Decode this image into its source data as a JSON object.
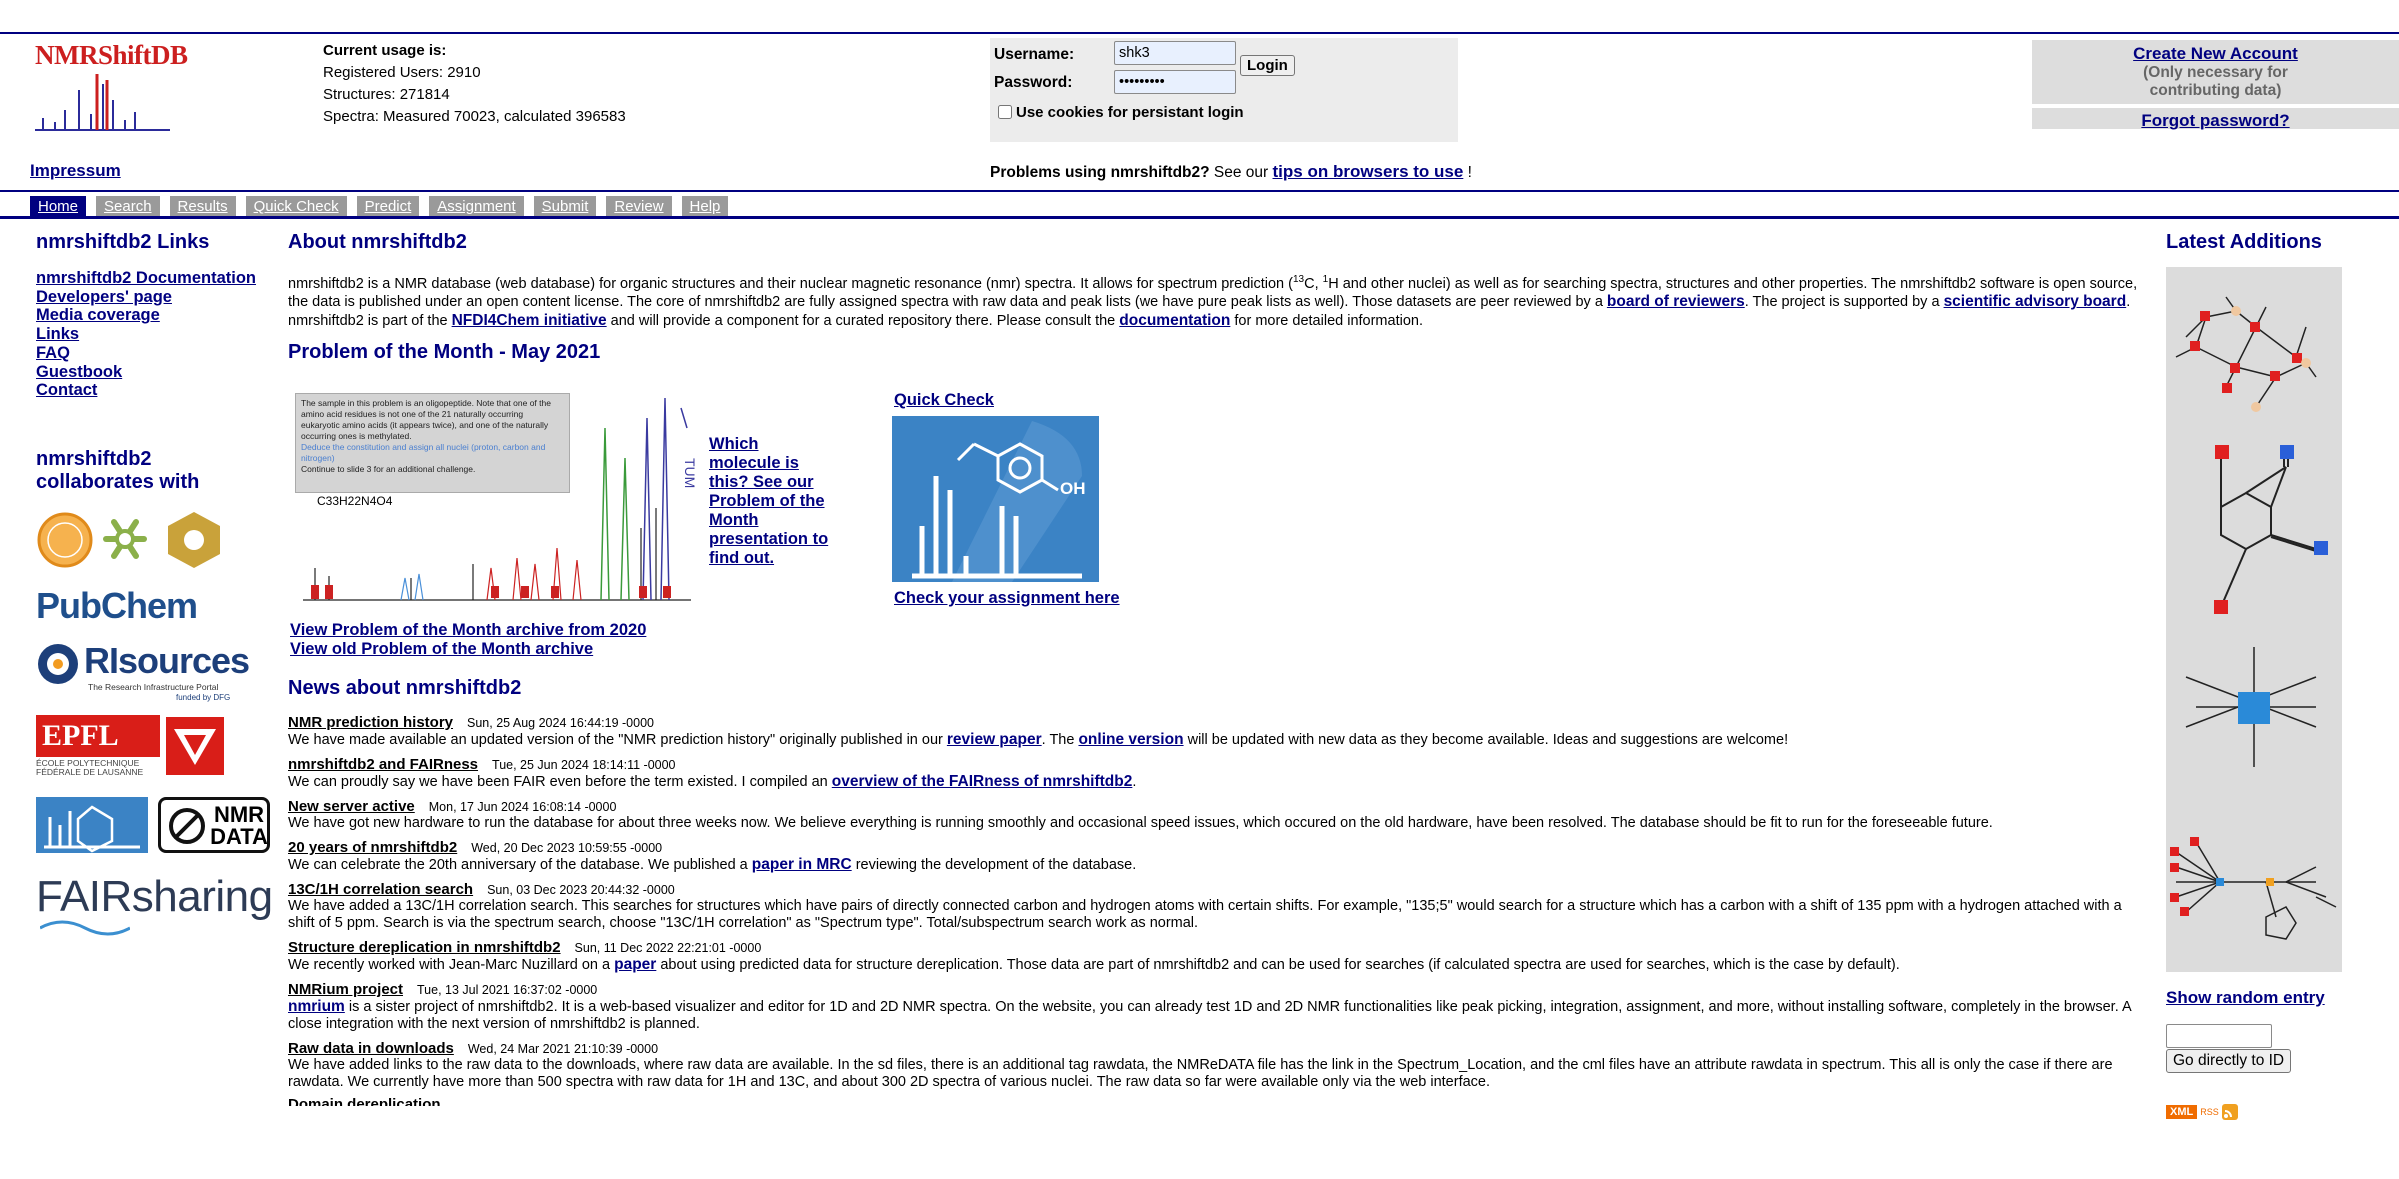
{
  "header": {
    "logo_text": "NMRShiftDB",
    "usage_heading": "Current usage is:",
    "registered_users": "Registered Users: 2910",
    "structures": "Structures: 271814",
    "spectra": "Spectra: Measured 70023, calculated 396583",
    "impressum": "Impressum"
  },
  "login": {
    "username_label": "Username:",
    "username_value": "shk3",
    "password_label": "Password:",
    "password_value": "•••••••••",
    "login_button": "Login",
    "cookie_label": "Use cookies for persistant login"
  },
  "account": {
    "create": "Create New Account",
    "note": "(Only necessary for contributing data)",
    "forgot": "Forgot password?"
  },
  "problems": {
    "prefix": "Problems using nmrshiftdb2?",
    "middle": " See our ",
    "link": "tips on browsers to use",
    "suffix": " !"
  },
  "tabs": [
    "Home",
    "Search",
    "Results",
    "Quick Check",
    "Predict",
    "Assignment",
    "Submit",
    "Review",
    "Help"
  ],
  "left": {
    "links_title": "nmrshiftdb2 Links",
    "links": [
      "nmrshiftdb2 Documentation",
      "Developers' page",
      "Media coverage",
      "Links",
      "FAQ",
      "Guestbook",
      "Contact"
    ],
    "collab_title": "nmrshiftdb2 collaborates with",
    "pubchem": "PubChem",
    "risources": "RIsources",
    "risources_sub": "The Research Infrastructure Portal",
    "risources_funded": "funded by DFG",
    "epfl": "EPFL",
    "epfl_sub1": "ÉCOLE POLYTECHNIQUE",
    "epfl_sub2": "FÉDÉRALE DE LAUSANNE",
    "nmrdata": "NMR DATA",
    "fairsharing": "FAIRsharing"
  },
  "main": {
    "about_title": "About nmrshiftdb2",
    "about_p1": "nmrshiftdb2 is a NMR database (web database) for organic structures and their nuclear magnetic resonance (nmr) spectra. It allows for spectrum prediction (",
    "about_c13": "13",
    "about_c": "C, ",
    "about_h1": "1",
    "about_p2": "H and other nuclei) as well as for searching spectra, structures and other properties. The nmrshiftdb2 software is open source, the data is published under an open content license. The core of nmrshiftdb2 are fully assigned spectra with raw data and peak lists (we have pure peak lists as well). Those datasets are peer reviewed by a ",
    "about_link1": "board of reviewers",
    "about_p3": ". The project is supported by a ",
    "about_link2": "scientific advisory board",
    "about_p4": ". nmrshiftdb2 is part of the ",
    "about_link3": "NFDI4Chem initiative",
    "about_p5": " and will provide a component for a curated repository there. Please consult the ",
    "about_link4": "documentation",
    "about_p6": " for more detailed information.",
    "potm_title": "Problem of the Month - May 2021",
    "potm_box_text1": "The sample in this problem is an oligopeptide. Note that one of the amino acid residues is not one of the 21 naturally occurring eukaryotic amino acids (it appears twice), and one of the naturally occurring ones is methylated.",
    "potm_box_text2": "Deduce the constitution and assign all nuclei (proton, carbon and nitrogen)",
    "potm_box_text3": "Continue to slide 3 for an additional challenge.",
    "potm_formula": "C33H22N4O4",
    "potm_link": "Which molecule is this? See our Problem of the Month presentation to find out.",
    "potm_archive1": "View Problem of the Month archive from 2020",
    "potm_archive2": "View old Problem of the Month archive",
    "quickcheck_title": "Quick Check",
    "quickcheck_oh": "OH",
    "quickcheck_link": "Check your assignment here",
    "news_title": "News about nmrshiftdb2",
    "news": [
      {
        "title": "NMR prediction history",
        "date": "Sun, 25 Aug 2024 16:44:19 -0000",
        "parts": [
          [
            "We have made available an updated version of the \"NMR prediction history\" originally published in our ",
            false
          ],
          [
            "review paper",
            true
          ],
          [
            ". The ",
            false
          ],
          [
            "online version",
            true
          ],
          [
            " will be updated with new data as they become available. Ideas and suggestions are welcome!",
            false
          ]
        ]
      },
      {
        "title": "nmrshiftdb2 and FAIRness",
        "date": "Tue, 25 Jun 2024 18:14:11 -0000",
        "parts": [
          [
            "We can proudly say we have been FAIR even before the term existed. I compiled an ",
            false
          ],
          [
            "overview of the FAIRness of nmrshiftdb2",
            true
          ],
          [
            ".",
            false
          ]
        ]
      },
      {
        "title": "New server active",
        "date": "Mon, 17 Jun 2024 16:08:14 -0000",
        "parts": [
          [
            "We have got new hardware to run the database for about three weeks now. We believe everything is running smoothly and occasional speed issues, which occured on the old hardware, have been resolved. The database should be fit to run for the foreseeable future.",
            false
          ]
        ]
      },
      {
        "title": "20 years of nmrshiftdb2",
        "date": "Wed, 20 Dec 2023 10:59:55 -0000",
        "parts": [
          [
            "We can celebrate the 20th anniversary of the database. We published a ",
            false
          ],
          [
            "paper in MRC",
            true
          ],
          [
            " reviewing the development of the database.",
            false
          ]
        ]
      },
      {
        "title": "13C/1H correlation search",
        "date": "Sun, 03 Dec 2023 20:44:32 -0000",
        "parts": [
          [
            "We have added a 13C/1H correlation search. This searches for structures which have pairs of directly connected carbon and hydrogen atoms with certain shifts. For example, \"135;5\" would search for a structure which has a carbon with a shift of 135 ppm with a hydrogen attached with a shift of 5 ppm. Search is via the spectrum search, choose \"13C/1H correlation\" as \"Spectrum type\". Total/subspectrum search work as normal.",
            false
          ]
        ]
      },
      {
        "title": "Structure dereplication in nmrshiftdb2",
        "date": "Sun, 11 Dec 2022 22:21:01 -0000",
        "parts": [
          [
            "We recently worked with Jean-Marc Nuzillard on a ",
            false
          ],
          [
            "paper",
            true
          ],
          [
            " about using predicted data for structure dereplication. Those data are part of nmrshiftdb2 and can be used for searches (if calculated spectra are used for searches, which is the case by default).",
            false
          ]
        ]
      },
      {
        "title": "NMRium project",
        "date": "Tue, 13 Jul 2021 16:37:02 -0000",
        "parts": [
          [
            "nmrium",
            true
          ],
          [
            " is a sister project of nmrshiftdb2. It is a web-based visualizer and editor for 1D and 2D NMR spectra. On the website, you can already test 1D and 2D NMR functionalities like peak picking, integration, assignment, and more, without installing software, completely in the browser. A close integration with the next version of nmrshiftdb2 is planned.",
            false
          ]
        ]
      },
      {
        "title": "Raw data in downloads",
        "date": "Wed, 24 Mar 2021 21:10:39 -0000",
        "parts": [
          [
            "We have added links to the raw data to the downloads, where raw data are available. In the sd files, there is an additional tag rawdata, the NMReDATA file has the link in the Spectrum_Location, and the cml files have an attribute rawdata in spectrum. This all is only the case if there are rawdata. We currently have more than 500 spectra with raw data for 1H and 13C, and about 300 2D spectra of various nuclei. The raw data so far were available only via the web interface.",
            false
          ]
        ]
      }
    ],
    "news_cut": "Domain dereplication"
  },
  "right": {
    "latest_title": "Latest Additions",
    "random_link": "Show random entry",
    "goto_button": "Go directly to ID",
    "xml_badge": "XML",
    "rss_label": "RSS"
  },
  "colors": {
    "navy": "#000080",
    "logo_red": "#cc1f1f",
    "tab_grey": "#9a9a9a",
    "sidebar_grey": "#dcdcdc",
    "qc_blue": "#3b83c5"
  }
}
